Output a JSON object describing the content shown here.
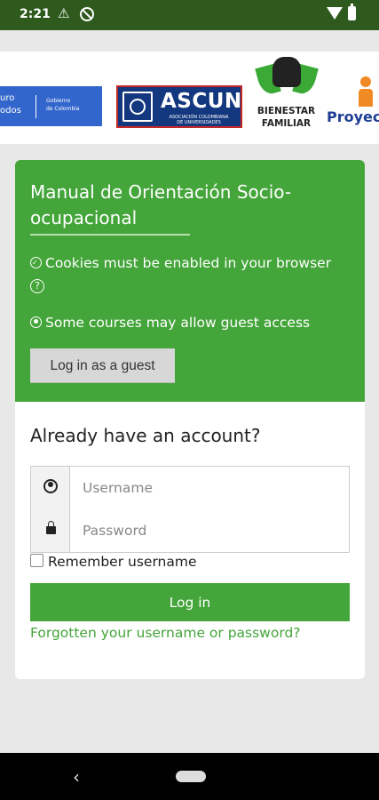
{
  "status_bar": {
    "time": "2:21"
  },
  "logos": {
    "gov": {
      "left_text_1": "uro",
      "left_text_2": "odos",
      "right_text_1": "Gobierno",
      "right_text_2": "de Colombia"
    },
    "ascun": {
      "name": "ASCUN",
      "subtitle_1": "ASOCIACIÓN COLOMBIANA",
      "subtitle_2": "DE UNIVERSIDADES"
    },
    "bienestar": {
      "line1": "BIENESTAR",
      "line2": "FAMILIAR"
    },
    "proyecto": {
      "text": "Proyec"
    }
  },
  "login": {
    "title": "Manual de Orientación Socio-ocupacional",
    "cookies_notice": "Cookies must be enabled in your browser",
    "guest_notice": "Some courses may allow guest access",
    "guest_button": "Log in as a guest",
    "heading": "Already have an account?",
    "username_placeholder": "Username",
    "password_placeholder": "Password",
    "remember_label": "Remember username",
    "login_button": "Log in",
    "forgot_link": "Forgotten your username or password?"
  },
  "colors": {
    "primary_green": "#44a53a",
    "status_bar": "#2f5a1e"
  }
}
